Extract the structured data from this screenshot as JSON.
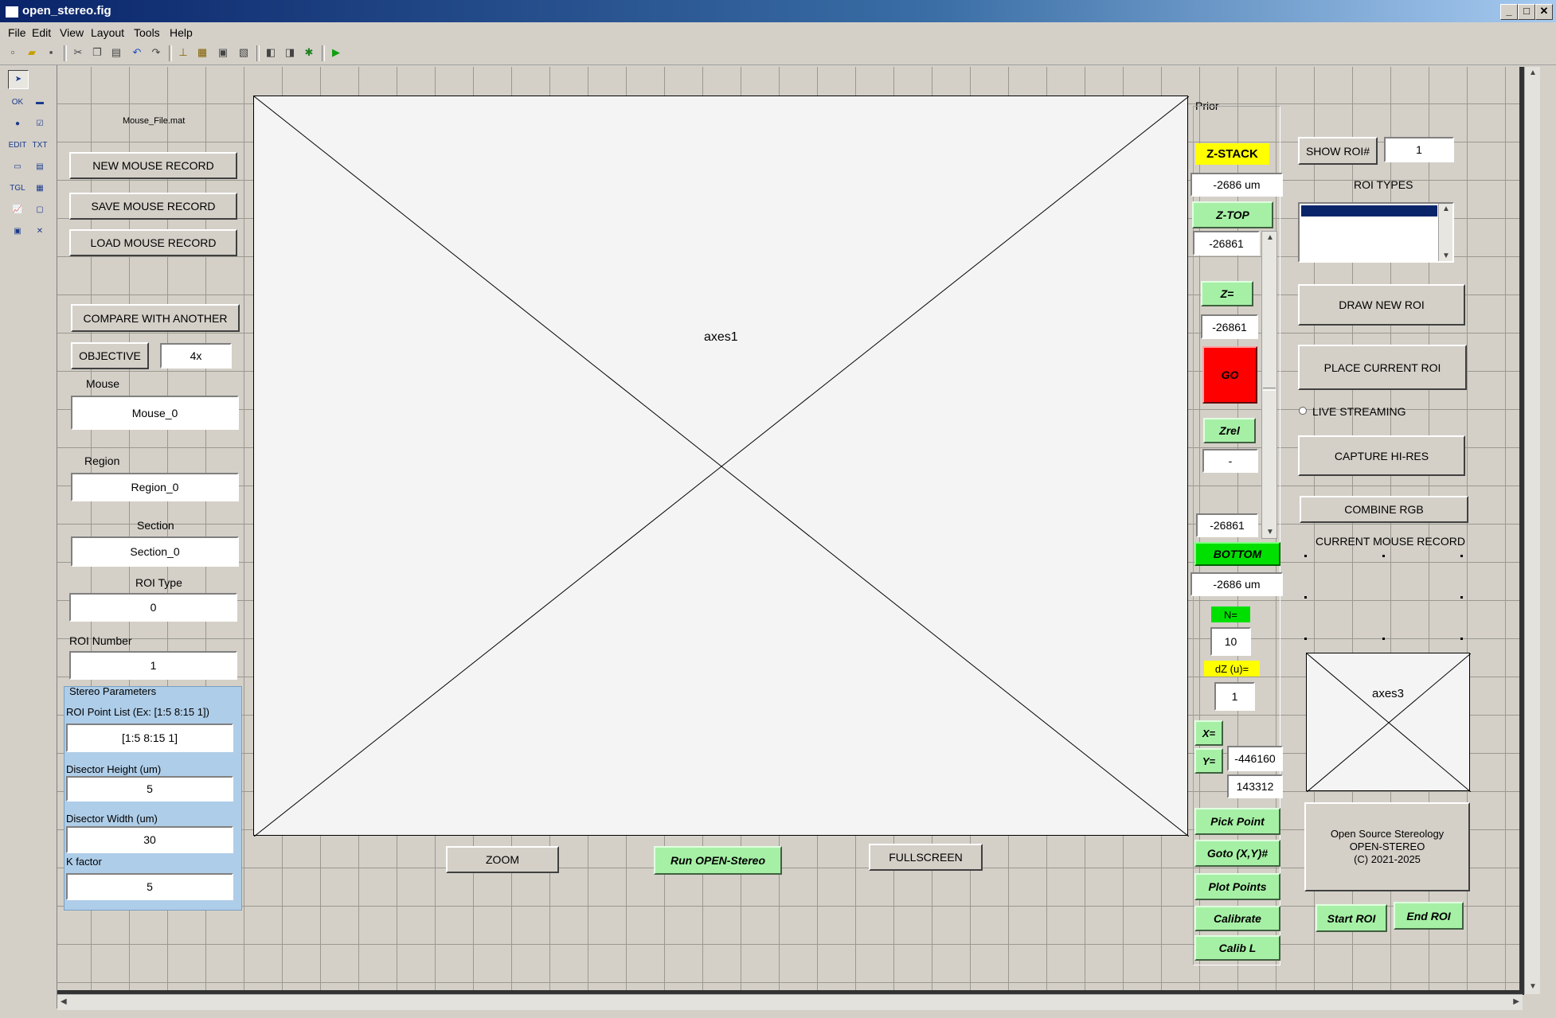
{
  "window": {
    "title": "open_stereo.fig",
    "minimize": "_",
    "maximize": "□",
    "close": "✕"
  },
  "menu": [
    "File",
    "Edit",
    "View",
    "Layout",
    "Tools",
    "Help"
  ],
  "left": {
    "file_label": "Mouse_File.mat",
    "new_mouse": "NEW MOUSE RECORD",
    "save_mouse": "SAVE MOUSE RECORD",
    "load_mouse": "LOAD MOUSE RECORD",
    "compare": "COMPARE WITH ANOTHER",
    "objective_btn": "OBJECTIVE",
    "objective_val": "4x",
    "mouse_lbl": "Mouse",
    "mouse_val": "Mouse_0",
    "region_lbl": "Region",
    "region_val": "Region_0",
    "section_lbl": "Section",
    "section_val": "Section_0",
    "roitype_lbl": "ROI Type",
    "roitype_val": "0",
    "roinum_lbl": "ROI Number",
    "roinum_val": "1"
  },
  "stereo": {
    "title": "Stereo Parameters",
    "point_list_lbl": "ROI Point List (Ex: [1:5 8:15 1])",
    "point_list_val": "[1:5 8:15 1]",
    "height_lbl": "Disector Height (um)",
    "height_val": "5",
    "width_lbl": "Disector Width (um)",
    "width_val": "30",
    "k_lbl": "K factor",
    "k_val": "5"
  },
  "main": {
    "axes1": "axes1",
    "zoom": "ZOOM",
    "run": "Run OPEN-Stereo",
    "fullscreen": "FULLSCREEN"
  },
  "prior": {
    "title": "Prior",
    "zstack": "Z-STACK",
    "zstack_val": "-2686 um",
    "ztop": "Z-TOP",
    "ztop_val": "-26861",
    "zeq": "Z=",
    "zeq_val": "-26861",
    "go": "GO",
    "zrel": "Zrel",
    "zrel_val": "-",
    "slider_val": "-26861",
    "bottom": "BOTTOM",
    "bottom_val": "-2686 um",
    "n_lbl": "N=",
    "n_val": "10",
    "dz_lbl": "dZ (u)=",
    "dz_val": "1",
    "x_btn": "X=",
    "y_btn": "Y=",
    "x_val": "-446160",
    "y_val": "143312",
    "pick_point": "Pick Point",
    "goto_xy": "Goto (X,Y)#",
    "plot_points": "Plot Points",
    "calibrate": "Calibrate",
    "calib_l": "Calib L"
  },
  "right": {
    "show_roi": "SHOW ROI#",
    "show_roi_val": "1",
    "roi_types": "ROI  TYPES",
    "draw_new": "DRAW NEW ROI",
    "place_current": "PLACE CURRENT ROI",
    "live": "LIVE STREAMING",
    "capture": "CAPTURE HI-RES",
    "combine": "COMBINE RGB",
    "current_record": "CURRENT MOUSE RECORD",
    "axes3": "axes3",
    "about_l1": "Open Source Stereology",
    "about_l2": "OPEN-STEREO",
    "about_l3": "(C) 2021-2025",
    "start_roi": "Start ROI",
    "end_roi": "End ROI"
  },
  "colors": {
    "green": "#a6f0a6",
    "bright_green": "#00e000",
    "yellow": "#ffff00",
    "red": "#ff0000"
  }
}
